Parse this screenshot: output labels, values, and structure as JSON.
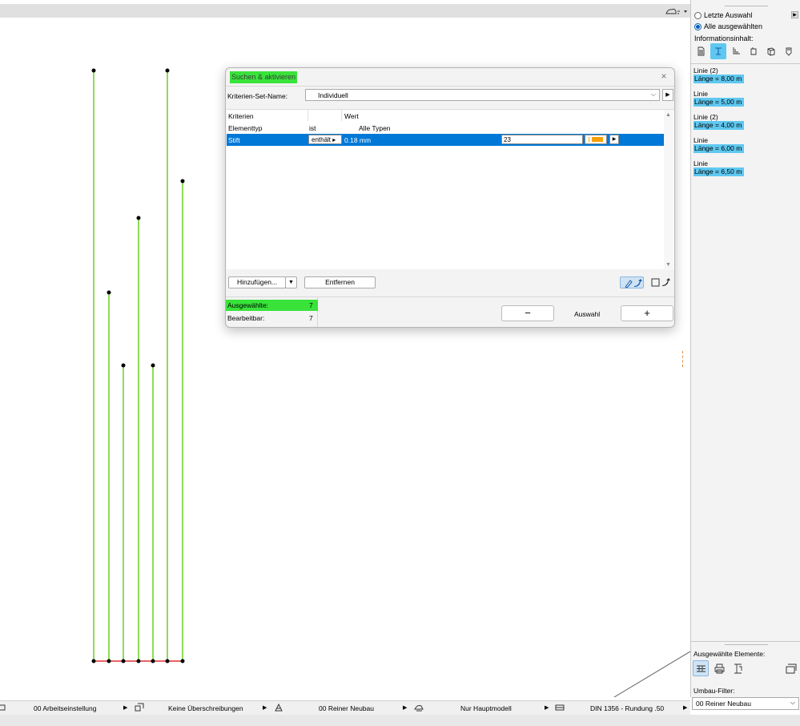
{
  "dialog": {
    "title": "Suchen & aktivieren",
    "close": "×",
    "set_label": "Kriterien-Set-Name:",
    "set_value": "Individuell",
    "table": {
      "headers": {
        "criteria": "Kriterien",
        "value": "Wert"
      },
      "row1": {
        "criteria": "Elementtyp",
        "operator": "ist",
        "value": "Alle Typen"
      },
      "row2": {
        "criteria": "Stift",
        "operator": "enthält",
        "value": "0.18 mm",
        "pen_number": "23"
      }
    },
    "add_button": "Hinzufügen...",
    "remove_button": "Entfernen",
    "selected_label": "Ausgewählte:",
    "selected_count": "7",
    "editable_label": "Bearbeitbar:",
    "editable_count": "7",
    "minus": "−",
    "selection_label": "Auswahl",
    "plus": "+"
  },
  "right_panel": {
    "radio_last": "Letzte Auswahl",
    "radio_all": "Alle ausgewählten",
    "info_label": "Informationsinhalt:",
    "entries": [
      {
        "type": "Linie (2)",
        "length": "Länge = 8,00 m"
      },
      {
        "type": "Linie",
        "length": "Länge = 5,00 m"
      },
      {
        "type": "Linie (2)",
        "length": "Länge = 4,00 m"
      },
      {
        "type": "Linie",
        "length": "Länge = 6,00 m"
      },
      {
        "type": "Linie",
        "length": "Länge = 6,50 m"
      }
    ],
    "selected_elements_label": "Ausgewählte Elemente:",
    "renovation_filter_label": "Umbau-Filter:",
    "renovation_filter_value": "00 Reiner Neubau"
  },
  "status_bar": {
    "work_setting": "00 Arbeitseinstellung",
    "overrides": "Keine Überschreibungen",
    "renovation": "00 Reiner Neubau",
    "model": "Nur Hauptmodell",
    "dimension": "DIN 1356 - Rundung .50"
  },
  "colors": {
    "green_highlight": "#39e33a",
    "cyan_highlight": "#5ec8f0",
    "selection_blue": "#0078d7",
    "line_green": "#6ad11f",
    "pen_orange": "#f5a000"
  }
}
